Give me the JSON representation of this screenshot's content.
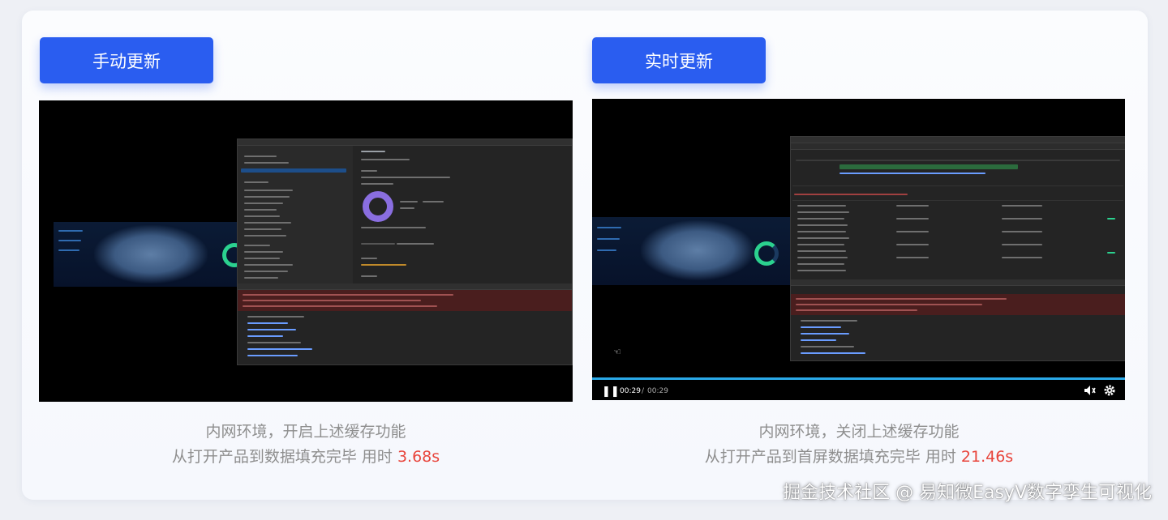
{
  "left_panel": {
    "button_label": "手动更新",
    "caption_line1": "内网环境，开启上述缓存功能",
    "caption_line2_prefix": "从打开产品到数据填充完毕 用时 ",
    "caption_time": "3.68s"
  },
  "right_panel": {
    "button_label": "实时更新",
    "caption_line1": "内网环境，关闭上述缓存功能",
    "caption_line2_prefix": "从打开产品到首屏数据填充完毕 用时 ",
    "caption_time": "21.46s",
    "player": {
      "current_time": "00:29",
      "separator": "/",
      "duration": "00:29",
      "progress": 1.0
    }
  },
  "watermark": "掘金技术社区 @ 易知微EasyV数字孪生可视化",
  "icons": {
    "pause": "pause-icon",
    "volume": "volume-icon",
    "settings": "gear-icon",
    "cursor": "mouse-cursor-icon"
  },
  "colors": {
    "button": "#2a5df0",
    "highlight": "#e8453c",
    "caption": "#8e8e8e",
    "progress": "#2aa9e8"
  }
}
